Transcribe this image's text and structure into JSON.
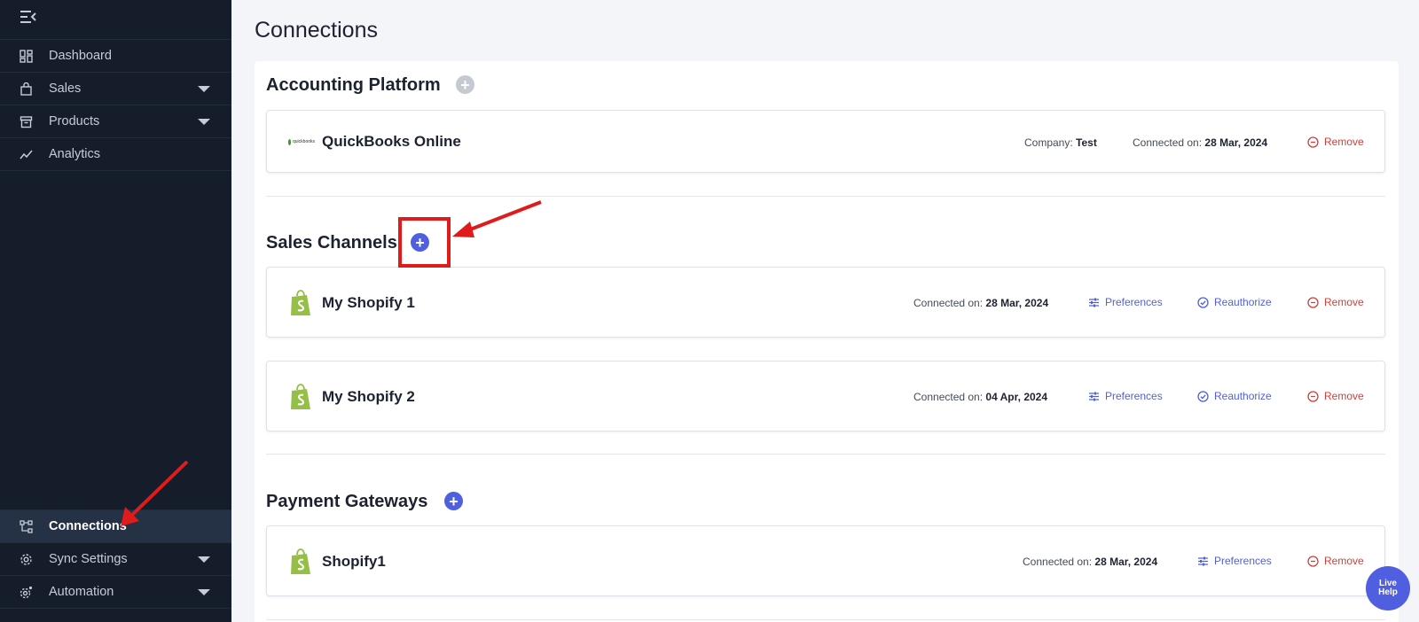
{
  "sidebar": {
    "items": [
      {
        "label": "Dashboard",
        "icon": "dashboard-icon"
      },
      {
        "label": "Sales",
        "icon": "bag-icon"
      },
      {
        "label": "Products",
        "icon": "box-icon"
      },
      {
        "label": "Analytics",
        "icon": "analytics-icon"
      },
      {
        "label": "Connections",
        "icon": "connections-icon"
      },
      {
        "label": "Sync Settings",
        "icon": "gear-icon"
      },
      {
        "label": "Automation",
        "icon": "automation-icon"
      }
    ]
  },
  "page": {
    "title": "Connections"
  },
  "sections": {
    "accounting": {
      "title": "Accounting Platform",
      "card": {
        "name": "QuickBooks Online",
        "logo_text": "quickbooks",
        "company_label": "Company:",
        "company_value": "Test",
        "connected_label": "Connected on:",
        "connected_value": "28 Mar, 2024",
        "remove": "Remove"
      }
    },
    "sales": {
      "title": "Sales Channels",
      "cards": [
        {
          "name": "My Shopify 1",
          "connected_label": "Connected on:",
          "connected_value": "28 Mar, 2024",
          "preferences": "Preferences",
          "reauthorize": "Reauthorize",
          "remove": "Remove"
        },
        {
          "name": "My Shopify 2",
          "connected_label": "Connected on:",
          "connected_value": "04 Apr, 2024",
          "preferences": "Preferences",
          "reauthorize": "Reauthorize",
          "remove": "Remove"
        }
      ]
    },
    "payments": {
      "title": "Payment Gateways",
      "card": {
        "name": "Shopify1",
        "connected_label": "Connected on:",
        "connected_value": "28 Mar, 2024",
        "preferences": "Preferences",
        "remove": "Remove"
      }
    }
  },
  "live_help": {
    "line1": "Live",
    "line2": "Help"
  },
  "colors": {
    "sidebar_bg": "#161d2a",
    "accent": "#4f5fe0",
    "danger": "#d0403a",
    "annotation": "#e01b1b",
    "shopify_green": "#95bf47"
  }
}
